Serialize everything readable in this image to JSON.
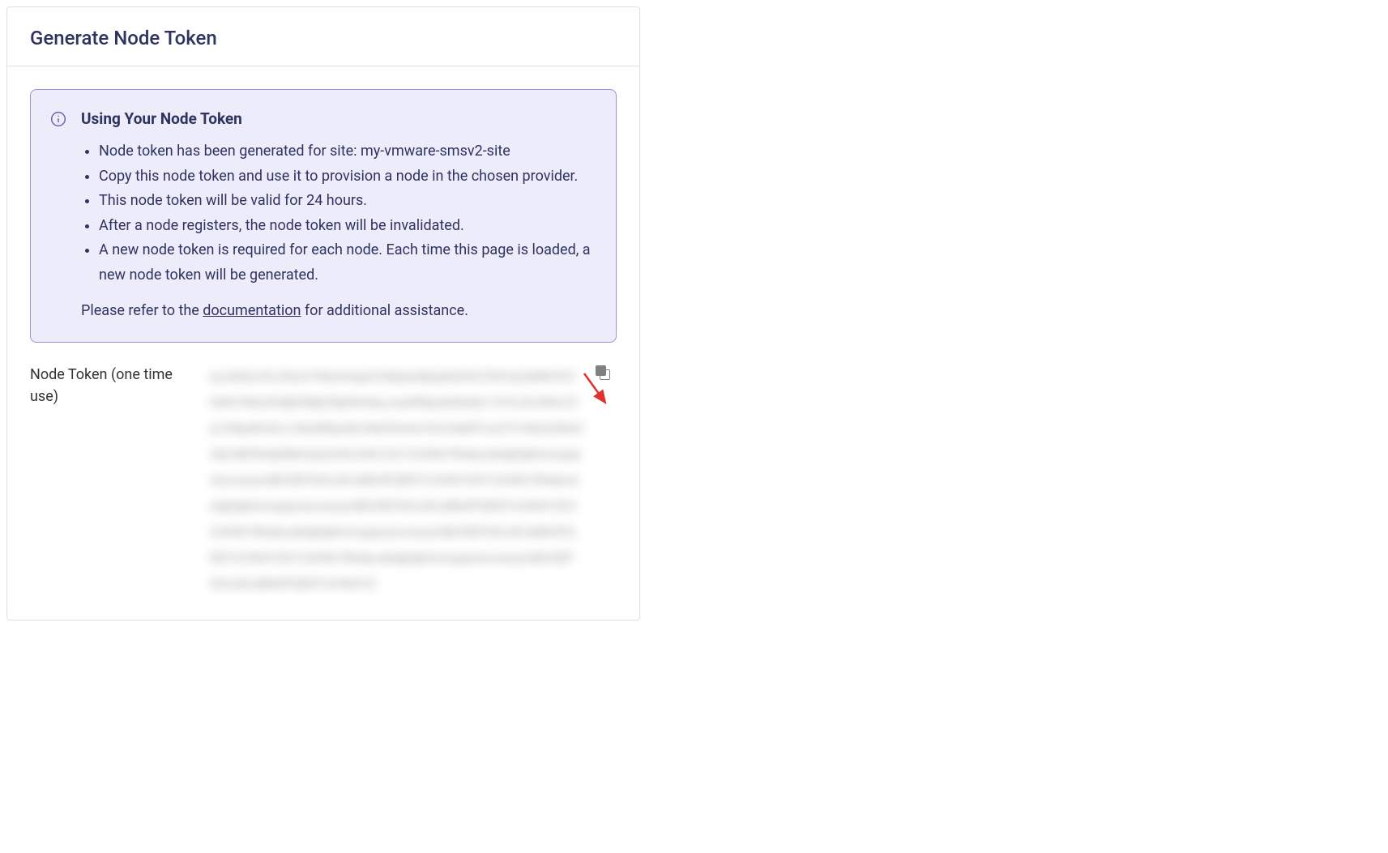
{
  "panel": {
    "title": "Generate Node Token"
  },
  "info": {
    "heading": "Using Your Node Token",
    "items": [
      "Node token has been generated for site: my-vmware-smsv2-site",
      "Copy this node token and use it to provision a node in the chosen provider.",
      "This node token will be valid for 24 hours.",
      "After a node registers, the node token will be invalidated.",
      "A new node token is required for each node. Each time this page is loaded, a new node token will be generated."
    ],
    "footer_prefix": "Please refer to the ",
    "footer_link": "documentation",
    "footer_suffix": " for additional assistance."
  },
  "token": {
    "label": "Node Token (one time use)",
    "value_redacted": "eyJhbGciOiJSUzI1NiIsImtpZCI6IjQwNjQyNzE4LTE0Yy0xMWVlLThiN2YtNzZhNjE5MjI2NjI5In0eyJzaXRlIjoibXktdm13YXJlLXNtc3YyLXNpdGUiLCJ0eXBlIjoibm9kZSIsImV4cCI6MTcwOTI1MzQ3Nn0AbCdEfGhIjKlMnOpQrStUvWxYz0123456789abcdefghijklmnopqrstuvwxyzABCDEFGHIJKLMNOPQRSTUVWXYZ0123456789abcdefghijklmnopqrstuvwxyzABCDEFGHIJKLMNOPQRSTUVWXYZ0123456789abcdefghijklmnopqrstuvwxyzABCDEFGHIJKLMNOPQRSTUVWXYZ0123456789abcdefghijklmnopqrstuvwxyzABCDEFGHIJKLMNOPQRSTUVWXYZ"
  }
}
